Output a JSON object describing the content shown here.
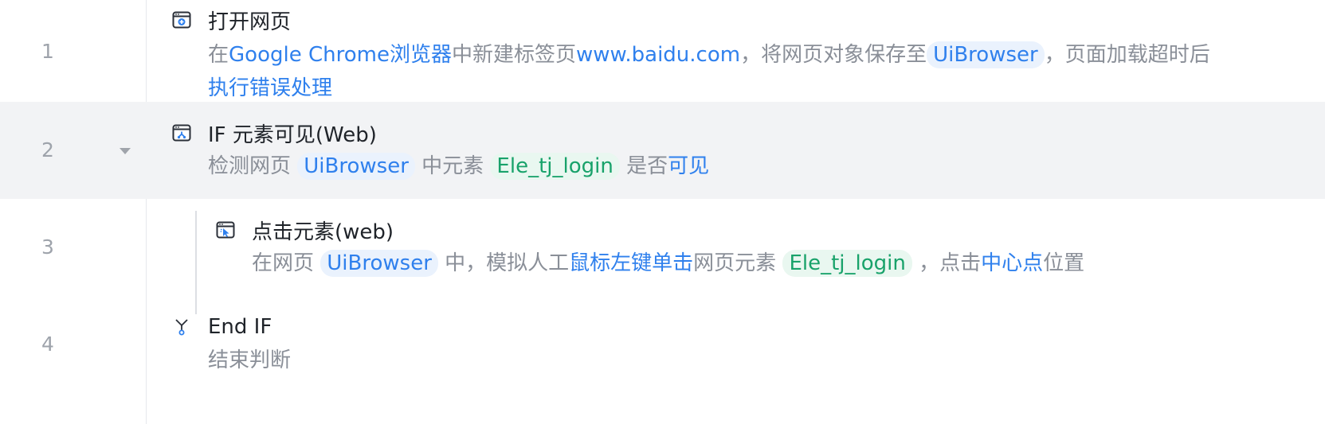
{
  "accent_colors": {
    "link": "#2f80ed",
    "variable_bg": "#eaf2fd",
    "element": "#18a26a",
    "element_bg": "#e9f7f0",
    "active_row_bg": "#f2f3f5"
  },
  "steps": [
    {
      "num": "1",
      "icon": "browser-open-icon",
      "title": "打开网页",
      "desc": {
        "p1": "在",
        "browser": "Google Chrome浏览器",
        "p2": "中新建标签页",
        "url": "www.baidu.com",
        "p3": "，将网页对象保存至",
        "var": "UiBrowser",
        "p4": "，页面加载超时后",
        "err": "执行错误处理"
      }
    },
    {
      "num": "2",
      "icon": "browser-condition-icon",
      "title": "IF 元素可见(Web)",
      "desc": {
        "p1": "检测网页 ",
        "var": "UiBrowser",
        "p2": " 中元素 ",
        "ele": "Ele_tj_login",
        "p3": " 是否",
        "cond": "可见"
      }
    },
    {
      "num": "3",
      "icon": "browser-click-icon",
      "title": "点击元素(web)",
      "desc": {
        "p1": "在网页 ",
        "var": "UiBrowser",
        "p2": " 中，模拟人工",
        "action": "鼠标左键单击",
        "p3": "网页元素 ",
        "ele": "Ele_tj_login",
        "p4": " ，点击",
        "pos": "中心点",
        "p5": "位置"
      }
    },
    {
      "num": "4",
      "icon": "end-if-branch-icon",
      "title": "End IF",
      "desc": {
        "p1": "结束判断"
      }
    }
  ]
}
